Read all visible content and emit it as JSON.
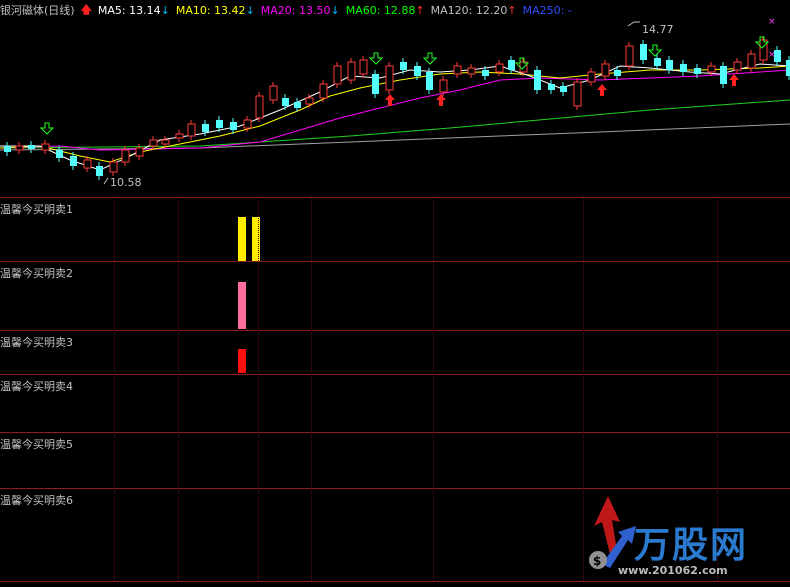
{
  "header": {
    "title": "银河磁体(日线)",
    "items": [
      {
        "label": "MA5: 13.14",
        "color": "#ffffff",
        "arrow": "↓",
        "arrow_color": "#00bfff"
      },
      {
        "label": "MA10: 13.42",
        "color": "#ffff00",
        "arrow": "↓",
        "arrow_color": "#00bfff"
      },
      {
        "label": "MA20: 13.50",
        "color": "#ff00ff",
        "arrow": "↓",
        "arrow_color": "#00bfff"
      },
      {
        "label": "MA60: 12.88",
        "color": "#00ff00",
        "arrow": "↑",
        "arrow_color": "#ff3030"
      },
      {
        "label": "MA120: 12.20",
        "color": "#c0c0c0",
        "arrow": "↑",
        "arrow_color": "#ff3030"
      },
      {
        "label": "MA250: -",
        "color": "#3050ff",
        "arrow": "",
        "arrow_color": ""
      }
    ]
  },
  "chart": {
    "high_label": "14.77",
    "low_label": "10.58"
  },
  "indicators": [
    {
      "label": "温馨今买明卖1"
    },
    {
      "label": "温馨今买明卖2"
    },
    {
      "label": "温馨今买明卖3"
    },
    {
      "label": "温馨今买明卖4"
    },
    {
      "label": "温馨今买明卖5"
    },
    {
      "label": "温馨今买明卖6"
    }
  ],
  "watermark": {
    "brand": "万股网",
    "url": "www.201062.com"
  },
  "colors": {
    "up": "#ff3b3b",
    "down": "#54ffff",
    "grid": "#8a1c1c",
    "ind1": "#ffee00",
    "ind2": "#ff6e9a",
    "ind3": "#ff1010"
  }
}
